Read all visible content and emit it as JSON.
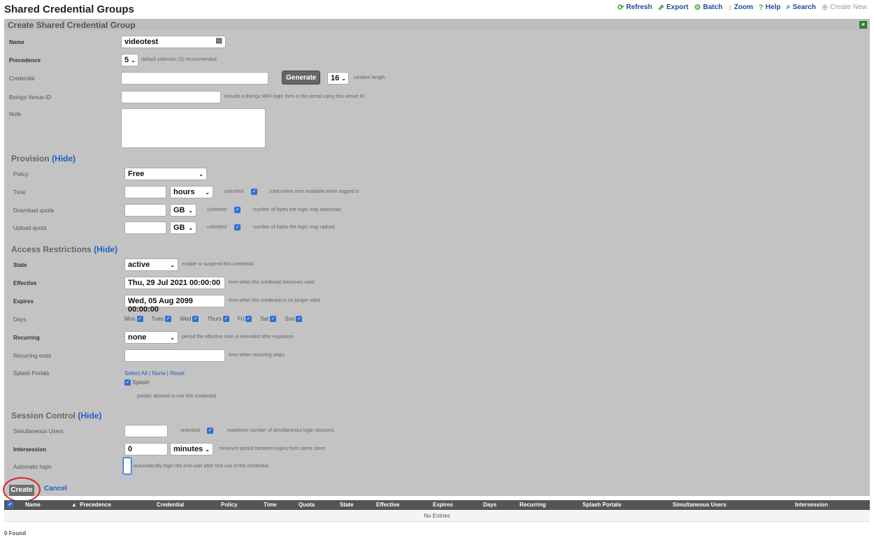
{
  "page": {
    "title": "Shared Credential Groups",
    "found": "0 Found"
  },
  "toolbar": {
    "refresh": "Refresh",
    "export": "Export",
    "batch": "Batch",
    "zoom": "Zoom",
    "help": "Help",
    "search": "Search",
    "create_new": "Create New"
  },
  "form": {
    "title": "Create Shared Credential Group",
    "name_label": "Name",
    "name_value": "videotest",
    "precedence_label": "Precedence",
    "precedence_value": "5",
    "precedence_hint": "default selection (5) recommended",
    "credential_label": "Credential",
    "credential_value": "",
    "generate_label": "Generate",
    "length_value": "16",
    "length_hint": "random length",
    "boingo_label": "Boingo Venue ID",
    "boingo_value": "",
    "boingo_hint": "include a Boingo WiFi login form in the portal using this venue ID",
    "note_label": "Note"
  },
  "provision": {
    "title": "Provision",
    "hide": "(Hide)",
    "policy_label": "Policy",
    "policy_value": "Free",
    "time_label": "Time",
    "time_unit": "hours",
    "time_unlimited": "unlimited",
    "time_hint": "total online time available when logged in",
    "download_label": "Download quota",
    "download_unit": "GB",
    "download_unlimited": "unlimited",
    "download_hint": "number of bytes the login may download",
    "upload_label": "Upload quota",
    "upload_unit": "GB",
    "upload_unlimited": "unlimited",
    "upload_hint": "number of bytes the login may upload"
  },
  "access": {
    "title": "Access Restrictions",
    "hide": "(Hide)",
    "state_label": "State",
    "state_value": "active",
    "state_hint": "enable or suspend this credential",
    "effective_label": "Effective",
    "effective_value": "Thu, 29 Jul 2021 00:00:00",
    "effective_hint": "time when the credential becomes valid",
    "expires_label": "Expires",
    "expires_value": "Wed, 05 Aug 2099 00:00:00",
    "expires_hint": "time when the credential is no longer valid",
    "days_label": "Days",
    "days": [
      "Mon",
      "Tues",
      "Wed",
      "Thurs",
      "Fri",
      "Sat",
      "Sun"
    ],
    "recurring_label": "Recurring",
    "recurring_value": "none",
    "recurring_hint": "period the effective time is extended after expiration",
    "recurring_ends_label": "Recurring ends",
    "recurring_ends_hint": "time when recurring stops",
    "splash_label": "Splash Portals",
    "select_all": "Select All",
    "none": "None",
    "reset": "Reset",
    "splash_item": "Splash",
    "splash_hint": "portals allowed to use this credential"
  },
  "session": {
    "title": "Session Control",
    "hide": "(Hide)",
    "sim_label": "Simultaneous Users",
    "sim_unlimited": "unlimited",
    "sim_hint": "maximum number of simultaneous login sessions",
    "inter_label": "Intersession",
    "inter_value": "0",
    "inter_unit": "minutes",
    "inter_hint": "minimum period between logins from same client",
    "auto_label": "Automatic login",
    "auto_hint": "automatically login the end-user after first use of the credential"
  },
  "actions": {
    "create": "Create",
    "cancel": "Cancel"
  },
  "table": {
    "columns": [
      "Name",
      "Precedence",
      "Credential",
      "Policy",
      "Time",
      "Quota",
      "State",
      "Effective",
      "Expires",
      "Days",
      "Recurring",
      "Splash Portals",
      "Simultaneous Users",
      "Intersession"
    ],
    "empty": "No Entries"
  },
  "colors": {
    "panel": "#c3c3c3",
    "link": "#1f5fbf",
    "checkbox": "#2f6fd8",
    "highlight": "#e02020"
  }
}
